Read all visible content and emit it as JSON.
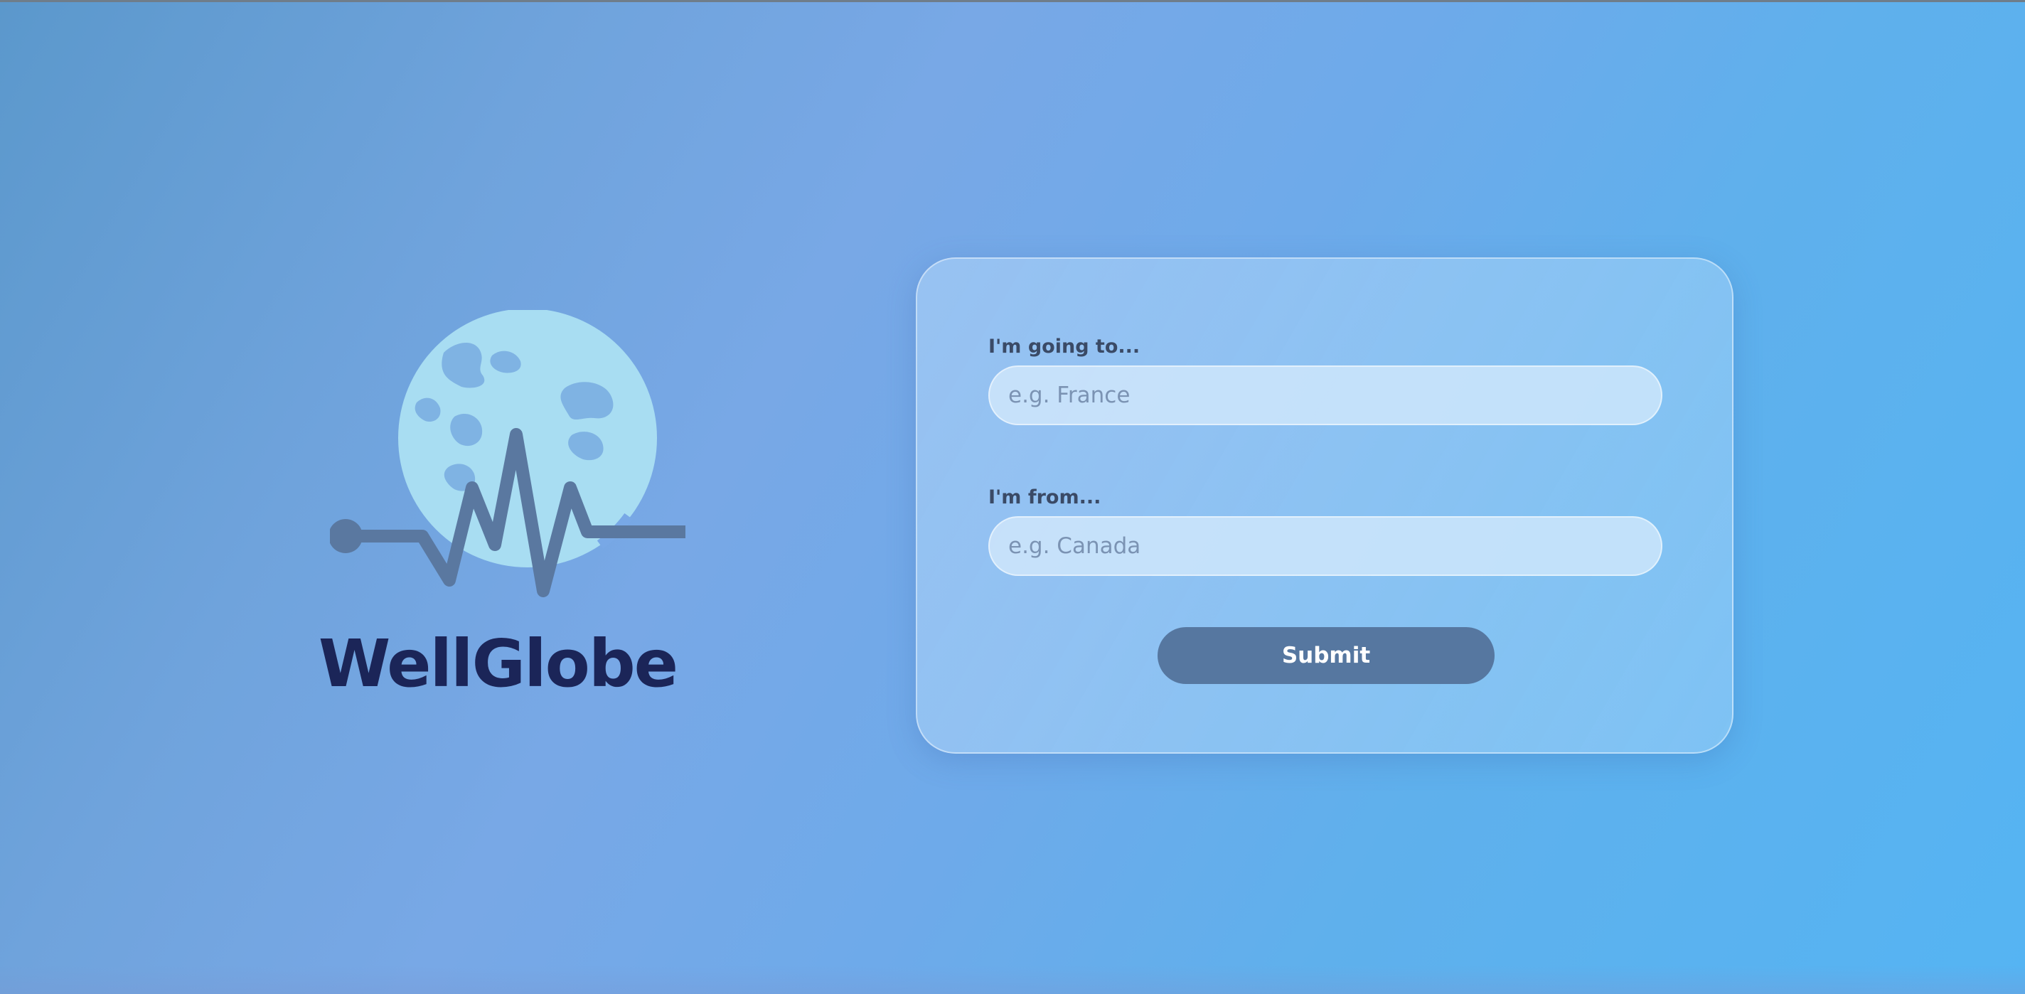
{
  "brand": {
    "name": "WellGlobe",
    "logo_icon": "globe-heartbeat-icon"
  },
  "form": {
    "destination": {
      "label": "I'm going to...",
      "placeholder": "e.g. France",
      "value": ""
    },
    "origin": {
      "label": "I'm from...",
      "placeholder": "e.g. Canada",
      "value": ""
    },
    "submit_label": "Submit"
  },
  "colors": {
    "brand_text": "#1b2558",
    "button": "#5677a0",
    "globe": "#a8ddf2",
    "pulse": "#5a78a0"
  }
}
